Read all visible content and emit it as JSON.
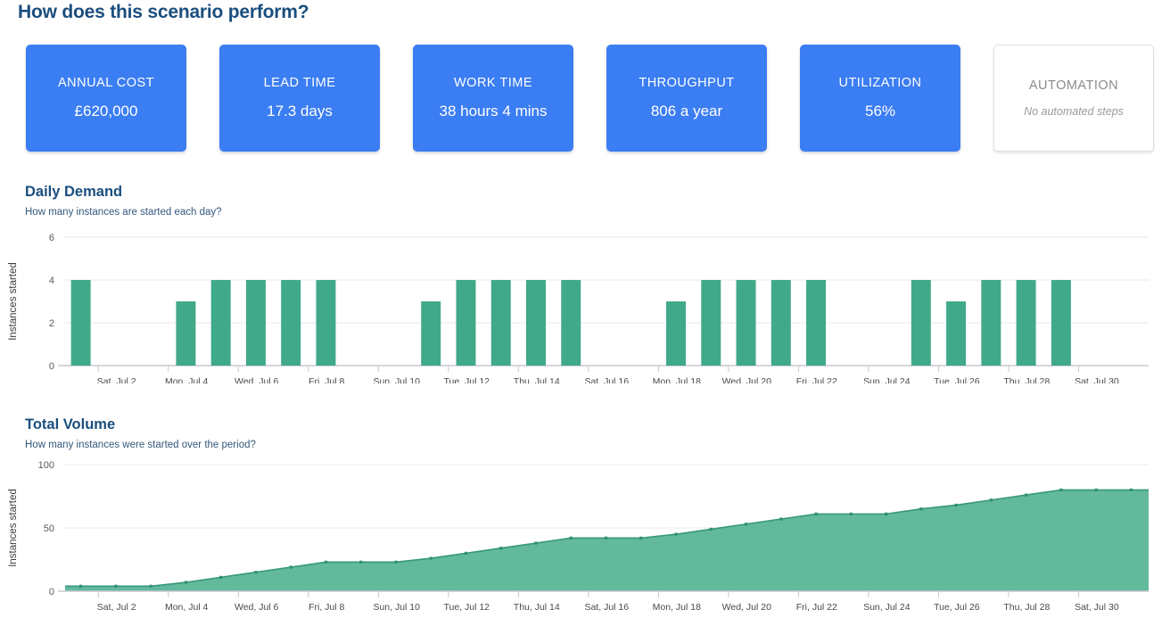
{
  "header": {
    "title": "How does this scenario perform?"
  },
  "kpis": [
    {
      "label": "ANNUAL COST",
      "value": "£620,000",
      "style": "blue"
    },
    {
      "label": "LEAD TIME",
      "value": "17.3 days",
      "style": "blue"
    },
    {
      "label": "WORK TIME",
      "value": "38 hours 4 mins",
      "style": "blue"
    },
    {
      "label": "THROUGHPUT",
      "value": "806 a year",
      "style": "blue"
    },
    {
      "label": "UTILIZATION",
      "value": "56%",
      "style": "blue"
    },
    {
      "label": "AUTOMATION",
      "value": "No automated steps",
      "style": "plain"
    }
  ],
  "colors": {
    "accent_blue": "#3B7DF2",
    "title_navy": "#1A4E7E",
    "series_green": "#40A98A",
    "area_green": "#55B394",
    "grid": "#e9e9e9",
    "card_border": "#e0e0e0"
  },
  "sections": {
    "daily_demand": {
      "title": "Daily Demand",
      "subtitle": "How many instances are started each day?"
    },
    "total_volume": {
      "title": "Total Volume",
      "subtitle": "How many instances were started over the period?"
    }
  },
  "chart_data": [
    {
      "type": "bar",
      "title": "Daily Demand",
      "subtitle": "How many instances are started each day?",
      "xlabel": "",
      "ylabel": "Instances started",
      "ylim": [
        0,
        6
      ],
      "yticks": [
        0,
        2,
        4,
        6
      ],
      "ytick_labels": [
        "0",
        "2",
        "4",
        "6"
      ],
      "grid": true,
      "legend": "none",
      "x_tick_labels": [
        "Sat, Jul 2",
        "Mon, Jul 4",
        "Wed, Jul 6",
        "Fri, Jul 8",
        "Sun, Jul 10",
        "Tue, Jul 12",
        "Thu, Jul 14",
        "Sat, Jul 16",
        "Mon, Jul 18",
        "Wed, Jul 20",
        "Fri, Jul 22",
        "Sun, Jul 24",
        "Tue, Jul 26",
        "Thu, Jul 28",
        "Sat, Jul 30"
      ],
      "x_tick_days": [
        2,
        4,
        6,
        8,
        10,
        12,
        14,
        16,
        18,
        20,
        22,
        24,
        26,
        28,
        30
      ],
      "categories": [
        "Jul 1",
        "Jul 2",
        "Jul 3",
        "Jul 4",
        "Jul 5",
        "Jul 6",
        "Jul 7",
        "Jul 8",
        "Jul 9",
        "Jul 10",
        "Jul 11",
        "Jul 12",
        "Jul 13",
        "Jul 14",
        "Jul 15",
        "Jul 16",
        "Jul 17",
        "Jul 18",
        "Jul 19",
        "Jul 20",
        "Jul 21",
        "Jul 22",
        "Jul 23",
        "Jul 24",
        "Jul 25",
        "Jul 26",
        "Jul 27",
        "Jul 28",
        "Jul 29",
        "Jul 30",
        "Jul 31"
      ],
      "values": [
        4,
        0,
        0,
        3,
        4,
        4,
        4,
        4,
        0,
        0,
        3,
        4,
        4,
        4,
        4,
        0,
        0,
        3,
        4,
        4,
        4,
        4,
        0,
        0,
        4,
        3,
        4,
        4,
        4,
        0,
        0
      ]
    },
    {
      "type": "area",
      "title": "Total Volume",
      "subtitle": "How many instances were started over the period?",
      "xlabel": "",
      "ylabel": "Instances started",
      "ylim": [
        0,
        100
      ],
      "yticks": [
        0,
        50,
        100
      ],
      "ytick_labels": [
        "0",
        "50",
        "100"
      ],
      "grid": true,
      "legend": "none",
      "x_tick_labels": [
        "Sat, Jul 2",
        "Mon, Jul 4",
        "Wed, Jul 6",
        "Fri, Jul 8",
        "Sun, Jul 10",
        "Tue, Jul 12",
        "Thu, Jul 14",
        "Sat, Jul 16",
        "Mon, Jul 18",
        "Wed, Jul 20",
        "Fri, Jul 22",
        "Sun, Jul 24",
        "Tue, Jul 26",
        "Thu, Jul 28",
        "Sat, Jul 30"
      ],
      "x_tick_days": [
        2,
        4,
        6,
        8,
        10,
        12,
        14,
        16,
        18,
        20,
        22,
        24,
        26,
        28,
        30
      ],
      "categories": [
        "Jul 1",
        "Jul 2",
        "Jul 3",
        "Jul 4",
        "Jul 5",
        "Jul 6",
        "Jul 7",
        "Jul 8",
        "Jul 9",
        "Jul 10",
        "Jul 11",
        "Jul 12",
        "Jul 13",
        "Jul 14",
        "Jul 15",
        "Jul 16",
        "Jul 17",
        "Jul 18",
        "Jul 19",
        "Jul 20",
        "Jul 21",
        "Jul 22",
        "Jul 23",
        "Jul 24",
        "Jul 25",
        "Jul 26",
        "Jul 27",
        "Jul 28",
        "Jul 29",
        "Jul 30",
        "Jul 31"
      ],
      "values": [
        4,
        4,
        4,
        7,
        11,
        15,
        19,
        23,
        23,
        23,
        26,
        30,
        34,
        38,
        42,
        42,
        42,
        45,
        49,
        53,
        57,
        61,
        61,
        61,
        65,
        68,
        72,
        76,
        80,
        80,
        80
      ]
    }
  ]
}
